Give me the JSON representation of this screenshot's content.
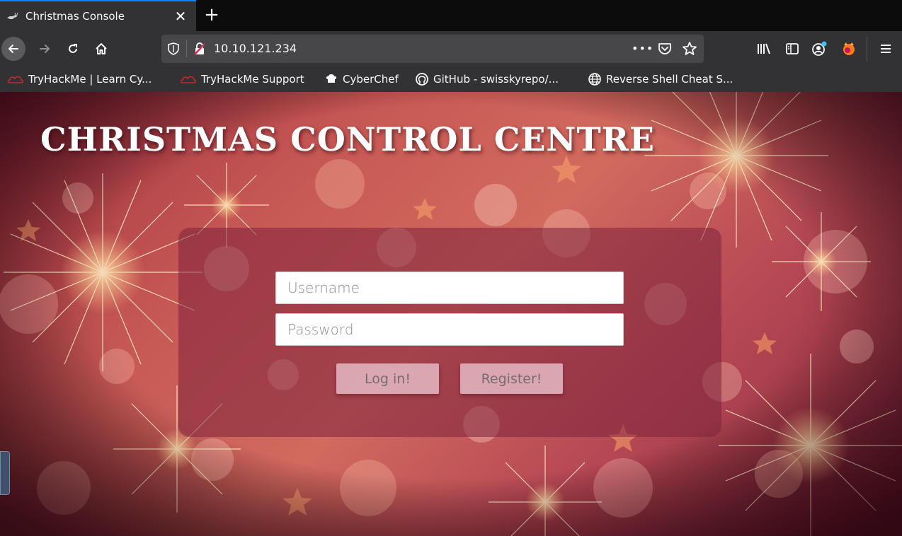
{
  "browser": {
    "tab": {
      "title": "Christmas Console",
      "close": "✕"
    },
    "new_tab": "+",
    "url": "10.10.121.234",
    "url_more": "•••",
    "bookmarks": [
      {
        "label": "TryHackMe | Learn Cy...",
        "icon": "tryhackme-icon"
      },
      {
        "label": "TryHackMe Support",
        "icon": "tryhackme-icon"
      },
      {
        "label": "CyberChef",
        "icon": "cyberchef-icon"
      },
      {
        "label": "GitHub - swisskyrepo/...",
        "icon": "github-icon"
      },
      {
        "label": "Reverse Shell Cheat S...",
        "icon": "globe-icon"
      }
    ]
  },
  "page": {
    "title": "CHRISTMAS CONTROL CENTRE",
    "username_placeholder": "Username",
    "password_placeholder": "Password",
    "login_label": "Log in!",
    "register_label": "Register!"
  },
  "colors": {
    "browser_chrome": "#323234",
    "tab_accent": "#0a84ff",
    "panel": "#7d233c",
    "button_fill": "#e6bec8"
  }
}
